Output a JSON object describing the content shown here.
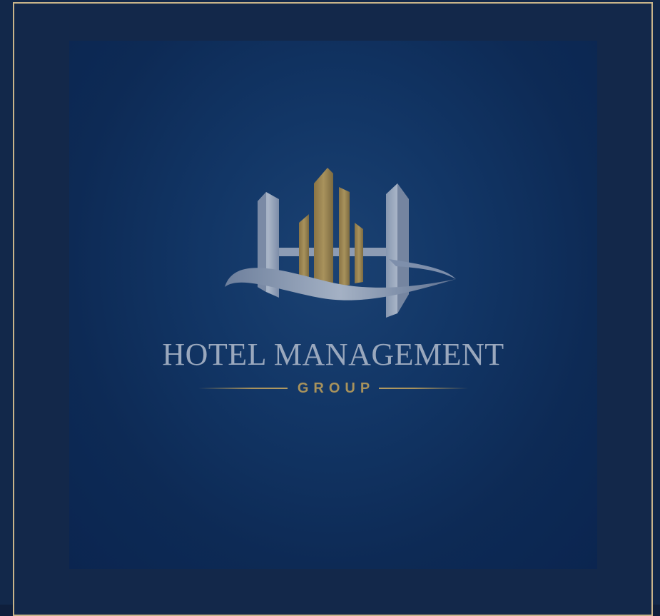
{
  "logo": {
    "title": "HOTEL MANAGEMENT",
    "subtitle": "GROUP",
    "icon": "skyline-buildings-swoosh-icon"
  },
  "colors": {
    "background": "#12284a",
    "frame_border": "#c8b48a",
    "card": "#123666",
    "silver": "#9aa8bd",
    "gold": "#a8925c"
  }
}
